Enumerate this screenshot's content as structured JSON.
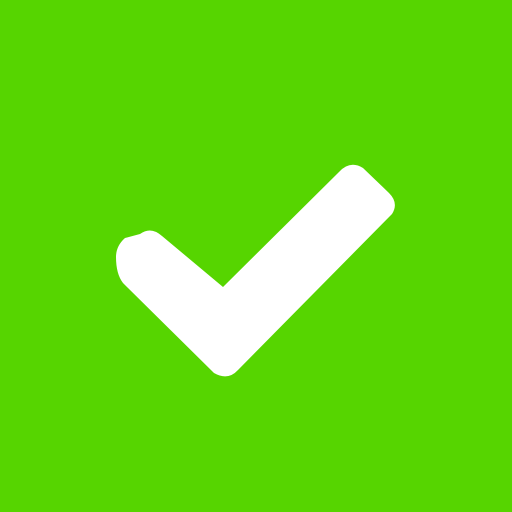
{
  "icon": {
    "name": "checkmark-icon",
    "background_color": "#56D500",
    "glyph_color": "#FFFFFF"
  }
}
